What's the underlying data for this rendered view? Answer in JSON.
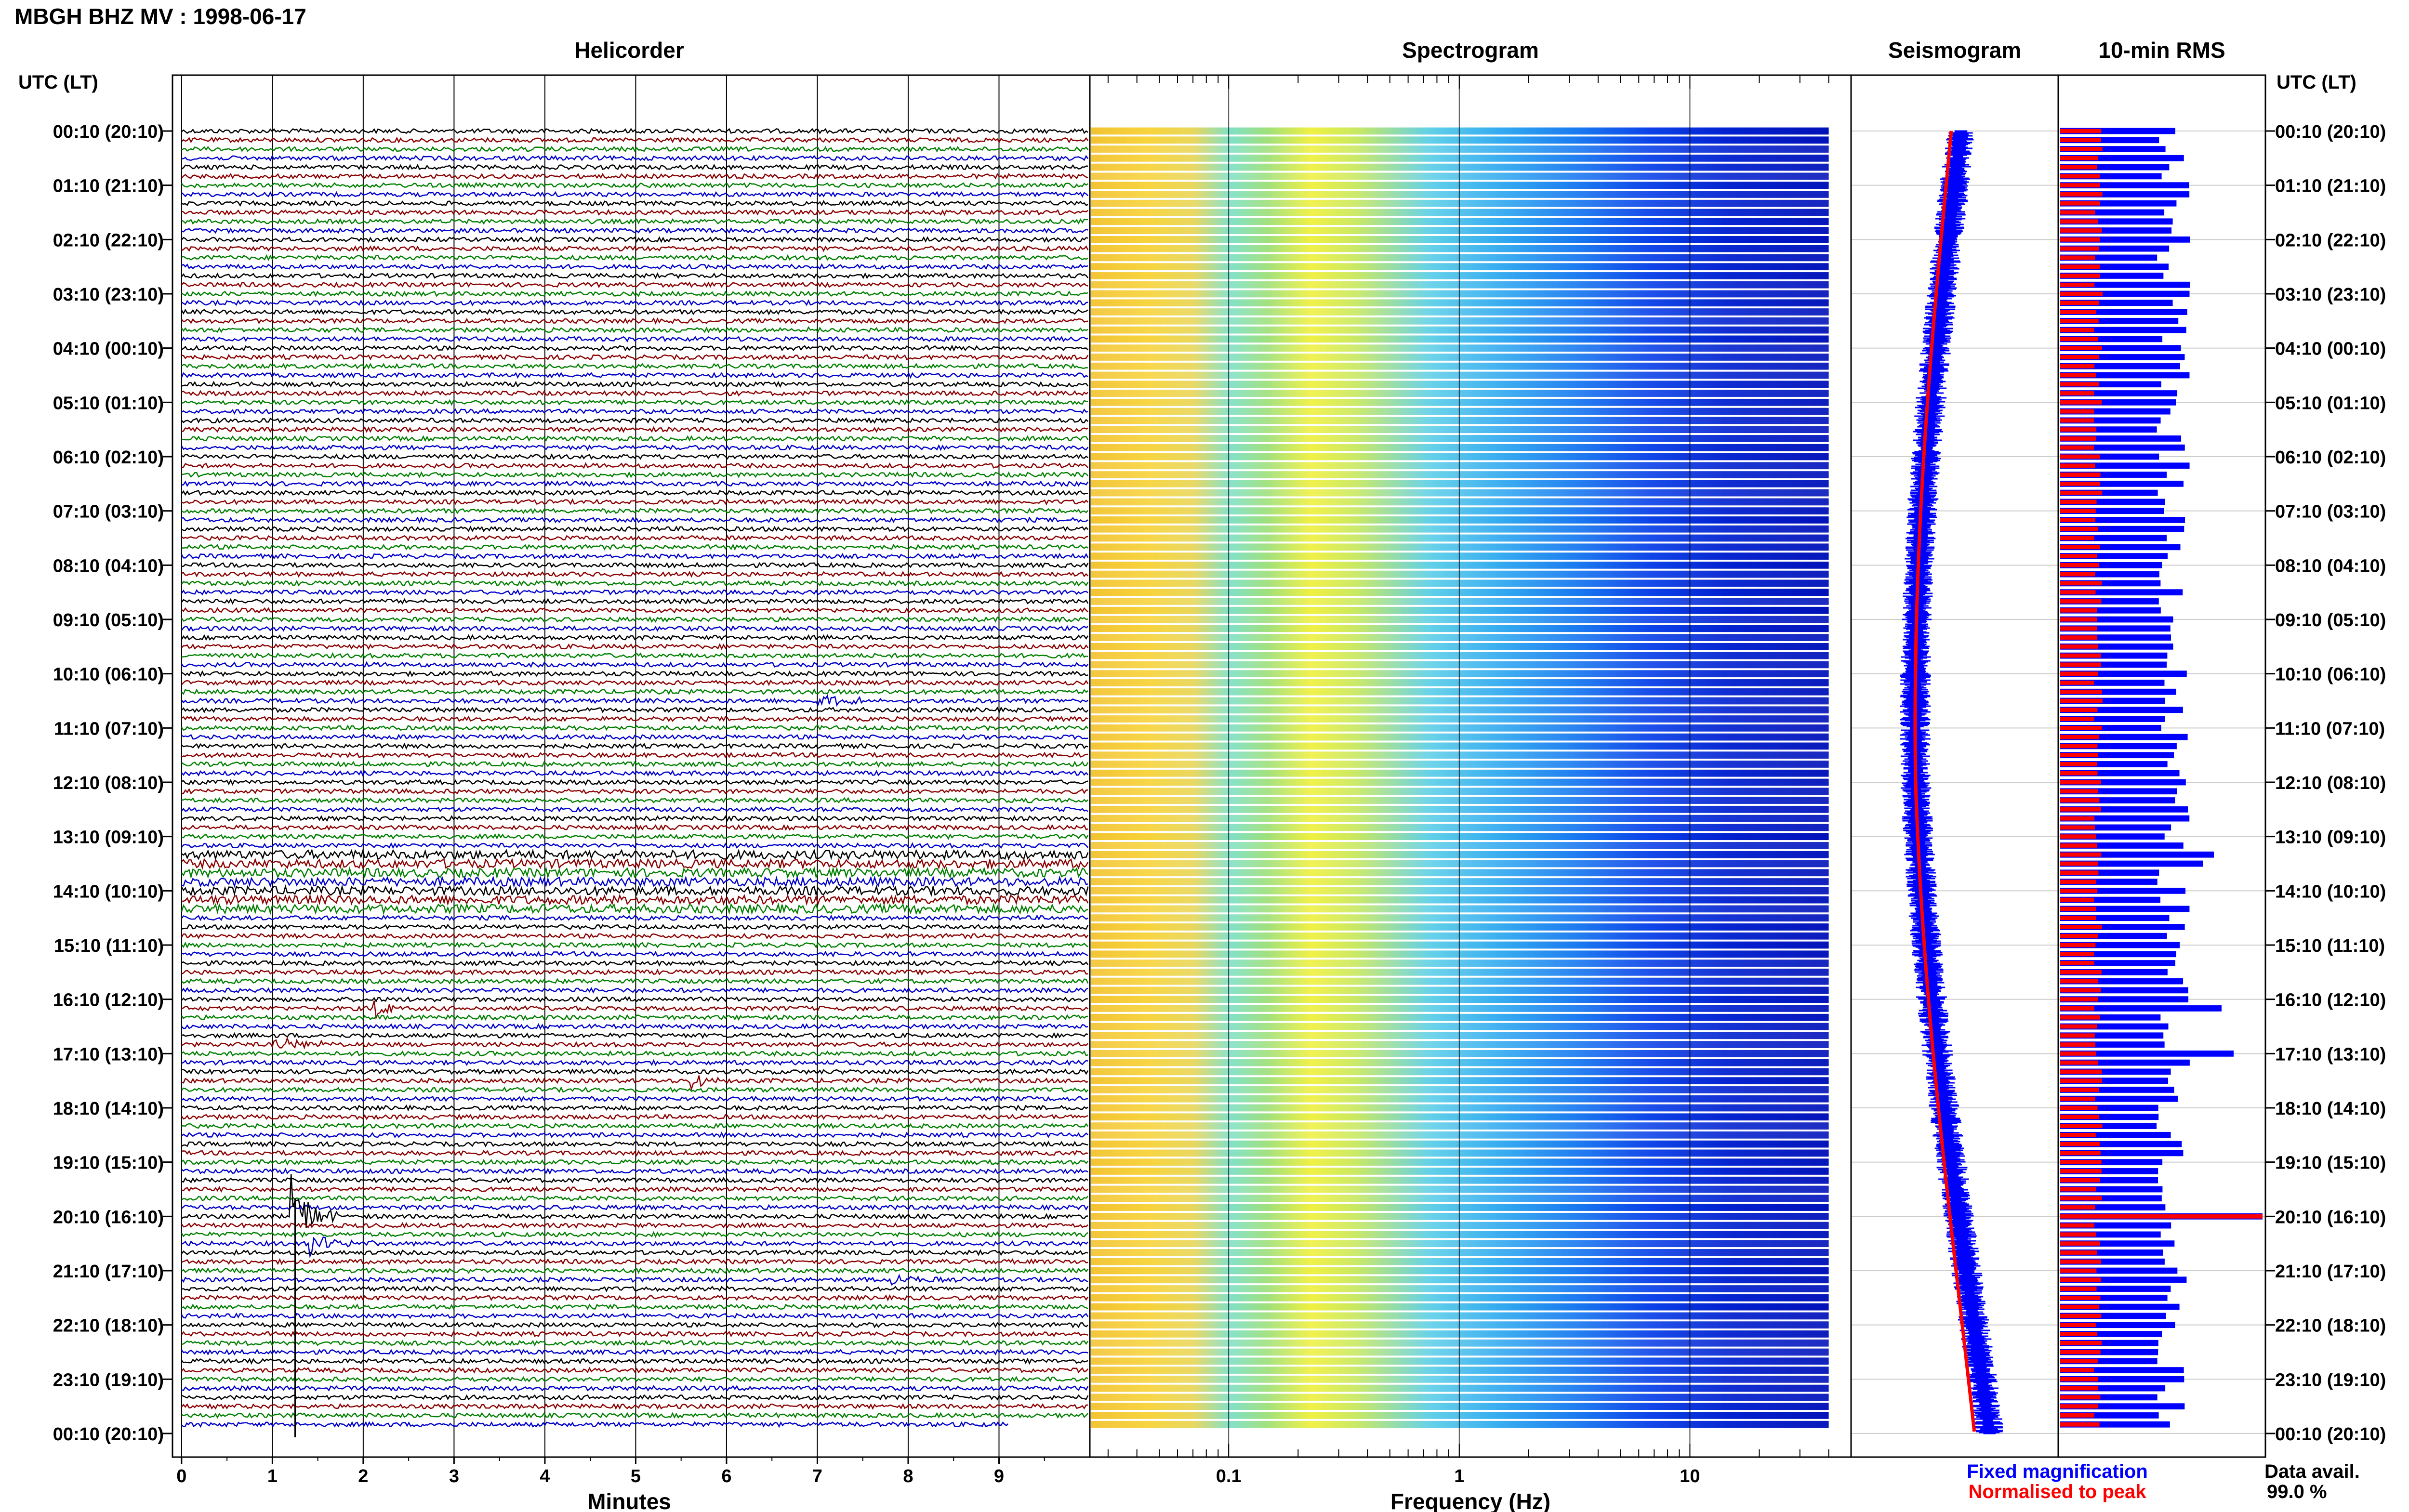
{
  "page": {
    "title": "MBGH BHZ MV : 1998-06-17",
    "time_header_left": "UTC (LT)",
    "time_header_right": "UTC (LT)",
    "time_labels": [
      "00:10 (20:10)",
      "01:10 (21:10)",
      "02:10 (22:10)",
      "03:10 (23:10)",
      "04:10 (00:10)",
      "05:10 (01:10)",
      "06:10 (02:10)",
      "07:10 (03:10)",
      "08:10 (04:10)",
      "09:10 (05:10)",
      "10:10 (06:10)",
      "11:10 (07:10)",
      "12:10 (08:10)",
      "13:10 (09:10)",
      "14:10 (10:10)",
      "15:10 (11:10)",
      "16:10 (12:10)",
      "17:10 (13:10)",
      "18:10 (14:10)",
      "19:10 (15:10)",
      "20:10 (16:10)",
      "21:10 (17:10)",
      "22:10 (18:10)",
      "23:10 (19:10)",
      "00:10 (20:10)"
    ],
    "legend_fixed": "Fixed magnification",
    "legend_normalised": "Normalised to peak",
    "data_avail_label": "Data avail.",
    "data_avail_value": "99.0 %",
    "colors": {
      "blue": "#0000ff",
      "red": "#ff0000",
      "trace_black": "#000000",
      "trace_red": "#8b0000",
      "trace_green": "#008000",
      "trace_blue": "#0000cd"
    }
  },
  "chart_data": [
    {
      "type": "line",
      "title": "Helicorder",
      "xlabel": "Minutes",
      "xlim": [
        -0.1,
        10
      ],
      "xticks": [
        0,
        1,
        2,
        3,
        4,
        5,
        6,
        7,
        8,
        9
      ],
      "rows": 144,
      "row_interval_min": 10,
      "trace_colors": [
        "black",
        "red",
        "green",
        "blue"
      ],
      "events": [
        {
          "row": 97,
          "minute": 2.1,
          "amplitude": 3.5,
          "duration_min": 0.3
        },
        {
          "row": 101,
          "minute": 1.0,
          "amplitude": 1.5,
          "duration_min": 1.0
        },
        {
          "row": 105,
          "minute": 5.6,
          "amplitude": 2.5,
          "duration_min": 0.4
        },
        {
          "row": 120,
          "minute": 1.2,
          "amplitude": 8.0,
          "duration_min": 0.6
        },
        {
          "row": 123,
          "minute": 1.4,
          "amplitude": 2.5,
          "duration_min": 0.7
        },
        {
          "row": 127,
          "minute": 7.8,
          "amplitude": 1.2,
          "duration_min": 1.0
        },
        {
          "row": 63,
          "minute": 7.0,
          "amplitude": 1.0,
          "duration_min": 1.2
        },
        {
          "row": 22,
          "minute": 6.8,
          "amplitude": 1.5,
          "duration_min": 0.2
        }
      ]
    },
    {
      "type": "heatmap",
      "title": "Spectrogram",
      "xlabel": "Frequency (Hz)",
      "xscale": "log",
      "xlim": [
        0.025,
        50
      ],
      "xticks": [
        0.1,
        1,
        10
      ],
      "xtick_labels": [
        "0.1",
        "1",
        "10"
      ],
      "rows": 144,
      "max_frequency_hz": 40
    },
    {
      "type": "line",
      "title": "Seismogram",
      "series": [
        {
          "name": "Fixed magnification",
          "color": "blue"
        },
        {
          "name": "Normalised to peak",
          "color": "red"
        }
      ]
    },
    {
      "type": "bar",
      "title": "10-min RMS",
      "rows": 144,
      "series": [
        {
          "name": "Fixed magnification",
          "color": "blue"
        },
        {
          "name": "Normalised to peak",
          "color": "red"
        }
      ]
    }
  ]
}
